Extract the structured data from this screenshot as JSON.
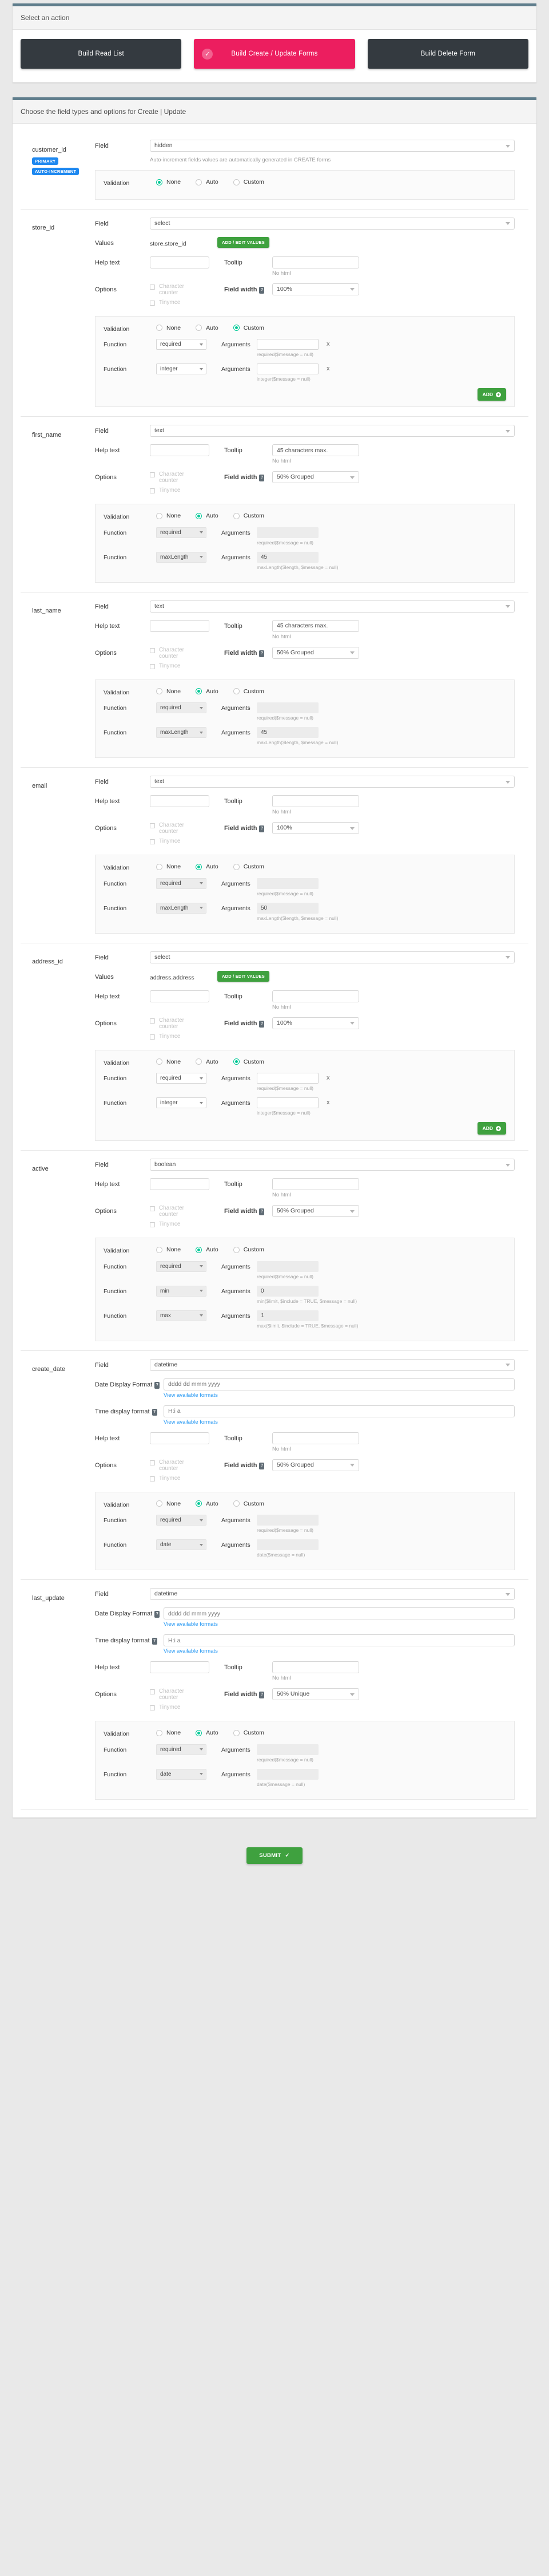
{
  "accent": {
    "selected_pink": "#ec1e5f",
    "dark": "#343a40",
    "green": "#3fa13f",
    "teal_radio": "#00c896",
    "badge_blue": "#1e88f0",
    "card_top": "#5f7d8c",
    "link_blue": "#2196f3"
  },
  "action_card": {
    "header": "Select an action",
    "buttons": [
      {
        "label": "Build Read List",
        "selected": false
      },
      {
        "label": "Build Create / Update Forms",
        "selected": true,
        "check": "✓"
      },
      {
        "label": "Build Delete Form",
        "selected": false
      }
    ]
  },
  "fields_card": {
    "header": "Choose the field types and options for Create | Update"
  },
  "labels": {
    "field": "Field",
    "values": "Values",
    "help_text": "Help text",
    "tooltip": "Tooltip",
    "options": "Options",
    "field_width": "Field width",
    "validation": "Validation",
    "function": "Function",
    "arguments": "Arguments",
    "date_display_format": "Date Display Format",
    "time_display_format": "Time display format",
    "view_formats": "View available formats",
    "no_html": "No html",
    "character_counter": "Character counter",
    "tinymce": "Tinymce",
    "add_edit_values": "ADD / EDIT VALUES",
    "add": "ADD",
    "remove": "x",
    "help_marker": "?",
    "none": "None",
    "auto": "Auto",
    "custom": "Custom",
    "submit": "SUBMIT",
    "submit_check": "✓"
  },
  "fields": [
    {
      "name": "customer_id",
      "badges": [
        "PRIMARY",
        "AUTO-INCREMENT"
      ],
      "field_type": "hidden",
      "note": "Auto-increment fields values are automatically generated in CREATE forms",
      "has_values": false,
      "has_helptext": false,
      "has_options": false,
      "has_dateformats": false,
      "validation_mode": "None",
      "functions": []
    },
    {
      "name": "store_id",
      "badges": [],
      "field_type": "select",
      "has_values": true,
      "values_text": "store.store_id",
      "has_helptext": true,
      "help_text_value": "",
      "tooltip_value": "",
      "has_options": true,
      "field_width": "100%",
      "has_dateformats": false,
      "validation_mode": "Custom",
      "show_add_button": true,
      "functions": [
        {
          "name": "required",
          "args": "",
          "signature": "required($message = null)",
          "removable": true
        },
        {
          "name": "integer",
          "args": "",
          "signature": "integer($message = null)",
          "removable": true
        }
      ]
    },
    {
      "name": "first_name",
      "badges": [],
      "field_type": "text",
      "has_values": false,
      "has_helptext": true,
      "help_text_value": "",
      "tooltip_value": "45 characters max.",
      "has_options": true,
      "field_width": "50% Grouped",
      "has_dateformats": false,
      "validation_mode": "Auto",
      "functions": [
        {
          "name": "required",
          "args": "",
          "signature": "required($message = null)",
          "removable": false
        },
        {
          "name": "maxLength",
          "args": "45",
          "signature": "maxLength($length, $message = null)",
          "removable": false
        }
      ]
    },
    {
      "name": "last_name",
      "badges": [],
      "field_type": "text",
      "has_values": false,
      "has_helptext": true,
      "help_text_value": "",
      "tooltip_value": "45 characters max.",
      "has_options": true,
      "field_width": "50% Grouped",
      "has_dateformats": false,
      "validation_mode": "Auto",
      "functions": [
        {
          "name": "required",
          "args": "",
          "signature": "required($message = null)",
          "removable": false
        },
        {
          "name": "maxLength",
          "args": "45",
          "signature": "maxLength($length, $message = null)",
          "removable": false
        }
      ]
    },
    {
      "name": "email",
      "badges": [],
      "field_type": "text",
      "has_values": false,
      "has_helptext": true,
      "help_text_value": "",
      "tooltip_value": "",
      "has_options": true,
      "field_width": "100%",
      "has_dateformats": false,
      "validation_mode": "Auto",
      "functions": [
        {
          "name": "required",
          "args": "",
          "signature": "required($message = null)",
          "removable": false
        },
        {
          "name": "maxLength",
          "args": "50",
          "signature": "maxLength($length, $message = null)",
          "removable": false
        }
      ]
    },
    {
      "name": "address_id",
      "badges": [],
      "field_type": "select",
      "has_values": true,
      "values_text": "address.address",
      "has_helptext": true,
      "help_text_value": "",
      "tooltip_value": "",
      "has_options": true,
      "field_width": "100%",
      "has_dateformats": false,
      "validation_mode": "Custom",
      "show_add_button": true,
      "functions": [
        {
          "name": "required",
          "args": "",
          "signature": "required($message = null)",
          "removable": true
        },
        {
          "name": "integer",
          "args": "",
          "signature": "integer($message = null)",
          "removable": true
        }
      ]
    },
    {
      "name": "active",
      "badges": [],
      "field_type": "boolean",
      "has_values": false,
      "has_helptext": true,
      "help_text_value": "",
      "tooltip_value": "",
      "has_options": true,
      "field_width": "50% Grouped",
      "has_dateformats": false,
      "validation_mode": "Auto",
      "functions": [
        {
          "name": "required",
          "args": "",
          "signature": "required($message = null)",
          "removable": false
        },
        {
          "name": "min",
          "args": "0",
          "signature": "min($limit, $include = TRUE, $message = null)",
          "removable": false
        },
        {
          "name": "max",
          "args": "1",
          "signature": "max($limit, $include = TRUE, $message = null)",
          "removable": false
        }
      ]
    },
    {
      "name": "create_date",
      "badges": [],
      "field_type": "datetime",
      "has_values": false,
      "has_helptext": true,
      "help_text_value": "",
      "tooltip_value": "",
      "has_options": true,
      "field_width": "50% Grouped",
      "has_dateformats": true,
      "date_format_placeholder": "dddd dd mmm yyyy",
      "time_format_placeholder": "H:i a",
      "validation_mode": "Auto",
      "functions": [
        {
          "name": "required",
          "args": "",
          "signature": "required($message = null)",
          "removable": false
        },
        {
          "name": "date",
          "args": "",
          "signature": "date($message = null)",
          "removable": false
        }
      ]
    },
    {
      "name": "last_update",
      "badges": [],
      "field_type": "datetime",
      "has_values": false,
      "has_helptext": true,
      "help_text_value": "",
      "tooltip_value": "",
      "has_options": true,
      "field_width": "50% Unique",
      "has_dateformats": true,
      "date_format_placeholder": "dddd dd mmm yyyy",
      "time_format_placeholder": "H:i a",
      "validation_mode": "Auto",
      "functions": [
        {
          "name": "required",
          "args": "",
          "signature": "required($message = null)",
          "removable": false
        },
        {
          "name": "date",
          "args": "",
          "signature": "date($message = null)",
          "removable": false
        }
      ]
    }
  ]
}
